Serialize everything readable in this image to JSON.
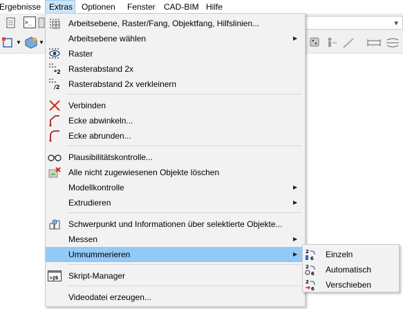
{
  "menubar": {
    "items": [
      {
        "label": "Ergebnisse"
      },
      {
        "label": "Extras"
      },
      {
        "label": "Optionen"
      },
      {
        "label": "Fenster"
      },
      {
        "label": "CAD-BIM"
      },
      {
        "label": "Hilfe"
      }
    ]
  },
  "extras_menu": {
    "items": [
      {
        "label": "Arbeitsebene, Raster/Fang, Objektfang, Hilfslinien...",
        "icon": "grid-settings-icon"
      },
      {
        "label": "Arbeitsebene wählen",
        "icon": "",
        "submenu": true
      },
      {
        "label": "Raster",
        "icon": "eye-grid-icon"
      },
      {
        "label": "Rasterabstand 2x",
        "icon": "grid-double-icon",
        "icon_text": "*2"
      },
      {
        "label": "Rasterabstand 2x verkleinern",
        "icon": "grid-half-icon",
        "icon_text": "/2"
      },
      {
        "label": "Verbinden",
        "icon": "connect-lines-icon"
      },
      {
        "label": "Ecke abwinkeln...",
        "icon": "chamfer-corner-icon"
      },
      {
        "label": "Ecke abrunden...",
        "icon": "round-corner-icon"
      },
      {
        "label": "Plausibilitätskontrolle...",
        "icon": "glasses-icon"
      },
      {
        "label": "Alle nicht zugewiesenen Objekte löschen",
        "icon": "delete-objects-icon"
      },
      {
        "label": "Modellkontrolle",
        "icon": "",
        "submenu": true
      },
      {
        "label": "Extrudieren",
        "icon": "",
        "submenu": true
      },
      {
        "label": "Schwerpunkt und Informationen über selektierte Objekte...",
        "icon": "centroid-info-icon"
      },
      {
        "label": "Messen",
        "icon": "",
        "submenu": true
      },
      {
        "label": "Umnummerieren",
        "icon": "",
        "submenu": true
      },
      {
        "label": "Skript-Manager",
        "icon": "script-manager-icon",
        "icon_text": ">JS"
      },
      {
        "label": "Videodatei erzeugen...",
        "icon": ""
      }
    ]
  },
  "renumber_submenu": {
    "items": [
      {
        "label": "Einzeln",
        "icon": "renumber-single-icon",
        "icon_text": "2 6"
      },
      {
        "label": "Automatisch",
        "icon": "renumber-auto-icon",
        "icon_text": "2 6"
      },
      {
        "label": "Verschieben",
        "icon": "renumber-shift-icon",
        "icon_text": "2 6"
      }
    ]
  },
  "colors": {
    "highlight": "#91c9f7",
    "menu_bg": "#f2f2f2",
    "active_menu": "#cce4f7"
  }
}
